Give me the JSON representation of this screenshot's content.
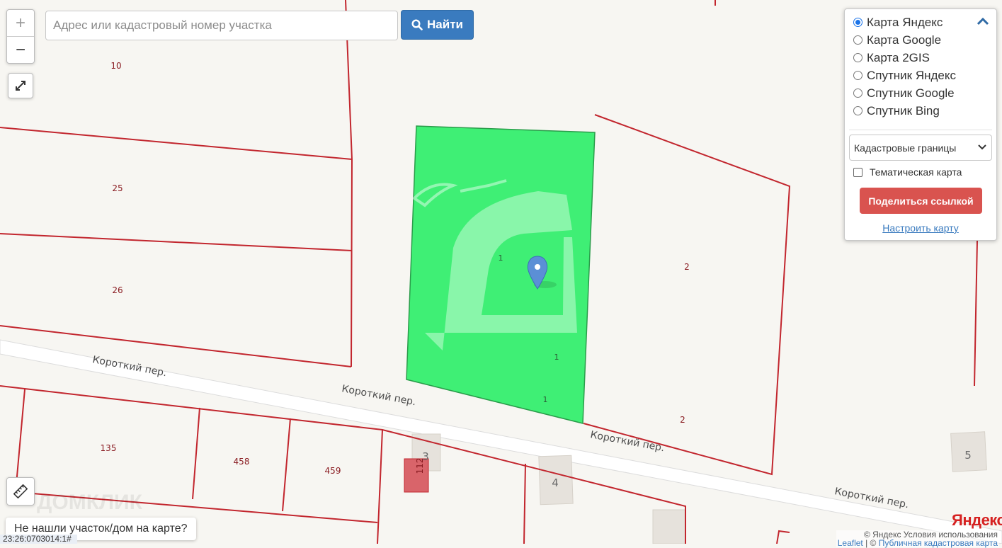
{
  "zoom": {
    "in_label": "+",
    "out_label": "−"
  },
  "search": {
    "placeholder": "Адрес или кадастровый номер участка",
    "button_label": "Найти"
  },
  "layers": {
    "options": [
      {
        "label": "Карта Яндекс",
        "selected": true
      },
      {
        "label": "Карта Google",
        "selected": false
      },
      {
        "label": "Карта 2GIS",
        "selected": false
      },
      {
        "label": "Спутник Яндекс",
        "selected": false
      },
      {
        "label": "Спутник Google",
        "selected": false
      },
      {
        "label": "Спутник Bing",
        "selected": false
      }
    ],
    "overlay_select": "Кадастровые границы",
    "thematic_checkbox": "Тематическая карта",
    "thematic_checked": false,
    "share_button": "Поделиться ссылкой",
    "setup_link": "Настроить карту"
  },
  "map": {
    "parcels": [
      "10",
      "25",
      "26",
      "1",
      "1",
      "1",
      "2",
      "2",
      "135",
      "458",
      "459",
      "112"
    ],
    "streets": [
      "Короткий пер.",
      "Короткий пер.",
      "Короткий пер.",
      "Короткий пер."
    ],
    "houses": [
      "3",
      "4",
      "5"
    ],
    "selected_color": "#3fef75",
    "boundary_color": "#c2262e"
  },
  "not_found_button": "Не нашли участок/дом на карте?",
  "coord_label": "23:26:0703014:1#",
  "attribution": {
    "line1": "© Яндекс Условия использования",
    "leaflet": "Leaflet",
    "sep": " | © ",
    "pkk": "Публичная кадастровая карта"
  },
  "yandex_logo": "Яндекс",
  "watermark": "ДОМКЛИК"
}
